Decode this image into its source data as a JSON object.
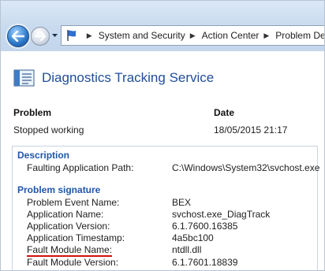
{
  "address": {
    "breadcrumbs": [
      "System and Security",
      "Action Center",
      "Problem Det"
    ]
  },
  "header": {
    "title": "Diagnostics Tracking Service"
  },
  "summary": {
    "problem_heading": "Problem",
    "date_heading": "Date",
    "problem_value": "Stopped working",
    "date_value": "18/05/2015 21:17"
  },
  "details": {
    "description_title": "Description",
    "description_rows": [
      {
        "label": "Faulting Application Path:",
        "value": "C:\\Windows\\System32\\svchost.exe"
      }
    ],
    "signature_title": "Problem signature",
    "signature_rows": [
      {
        "label": "Problem Event Name:",
        "value": "BEX"
      },
      {
        "label": "Application Name:",
        "value": "svchost.exe_DiagTrack"
      },
      {
        "label": "Application Version:",
        "value": "6.1.7600.16385"
      },
      {
        "label": "Application Timestamp:",
        "value": "4a5bc100"
      },
      {
        "label": "Fault Module Name:",
        "value": "ntdll.dll"
      },
      {
        "label": "Fault Module Version:",
        "value": "6.1.7601.18839"
      }
    ]
  },
  "colors": {
    "title_blue": "#1f4e99",
    "section_blue": "#1f56a8",
    "highlight_red": "#d01010"
  }
}
